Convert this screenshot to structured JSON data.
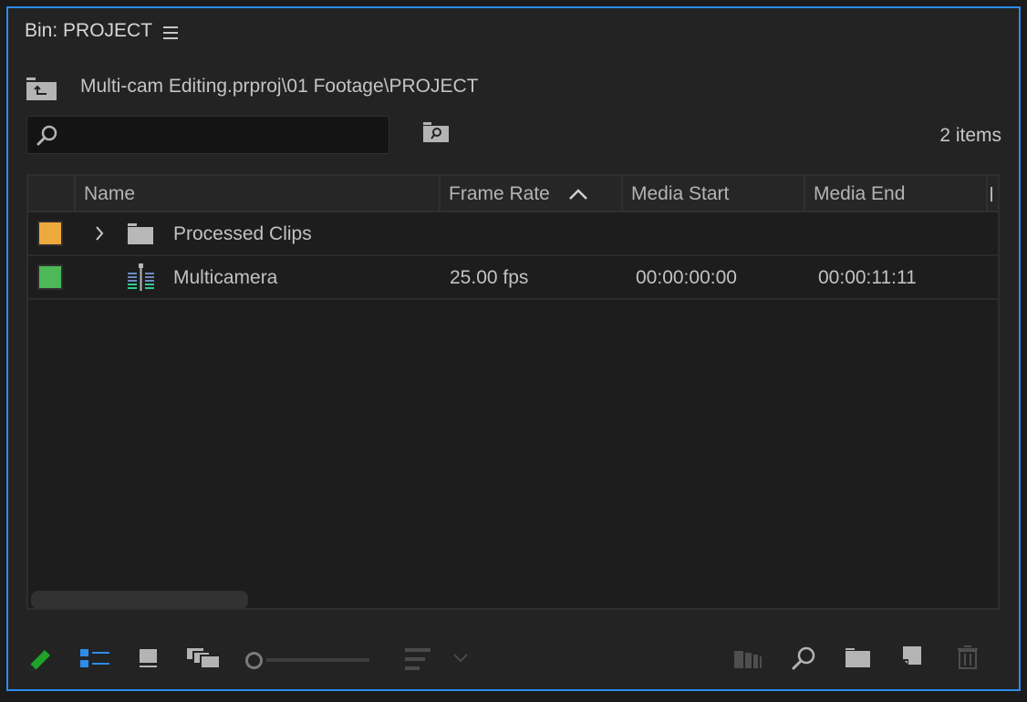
{
  "panel": {
    "title": "Bin: PROJECT",
    "menu_icon": "hamburger-menu-icon",
    "path": "Multi-cam Editing.prproj\\01 Footage\\PROJECT",
    "up_icon": "folder-up-icon",
    "accent_color": "#2d8ceb"
  },
  "search": {
    "value": "",
    "placeholder": "",
    "icon": "search-icon",
    "find_bin_icon": "find-in-bin-icon"
  },
  "item_count": "2 items",
  "table": {
    "columns": [
      {
        "label": ""
      },
      {
        "label": "Name"
      },
      {
        "label": "Frame Rate",
        "sorted": "ascending"
      },
      {
        "label": "Media Start"
      },
      {
        "label": "Media End"
      },
      {
        "label": ""
      }
    ],
    "rows": [
      {
        "label_color": "#eea93c",
        "expandable": true,
        "icon": "folder-icon",
        "name": "Processed Clips",
        "frame_rate": "",
        "media_start": "",
        "media_end": ""
      },
      {
        "label_color": "#4db857",
        "expandable": false,
        "icon": "multicam-sequence-icon",
        "name": "Multicamera",
        "frame_rate": "25.00 fps",
        "media_start": "00:00:00:00",
        "media_end": "00:00:11:11"
      }
    ]
  },
  "toolbar": {
    "left": [
      "pencil-icon",
      "list-view-icon",
      "icon-view-icon",
      "freeform-view-icon",
      "zoom-slider",
      "sort-icons-icon",
      "sort-dropdown-icon"
    ],
    "right": [
      "automate-to-sequence-icon",
      "find-icon",
      "new-bin-icon",
      "new-item-icon",
      "trash-icon"
    ],
    "zoom_slider_value": 0
  }
}
